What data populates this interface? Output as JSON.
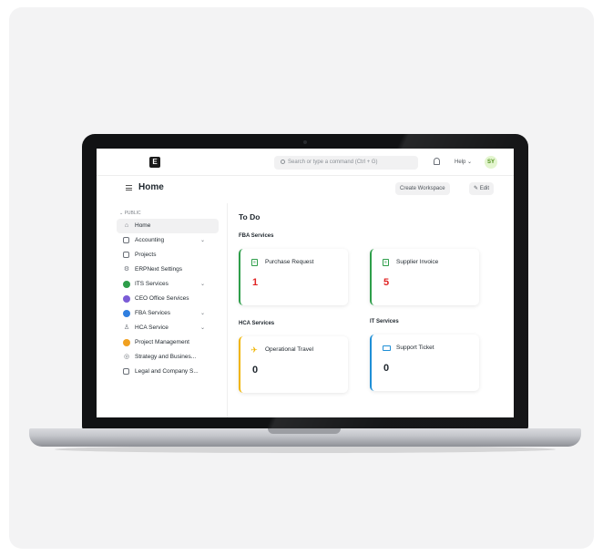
{
  "navbar": {
    "logo_letter": "E",
    "search_placeholder": "Search or type a command (Ctrl + G)",
    "help_label": "Help ⌄",
    "avatar_initials": "SY"
  },
  "page": {
    "title": "Home",
    "create_workspace_label": "Create Workspace",
    "edit_label": "Edit"
  },
  "sidebar": {
    "section_label": "⌄ PUBLIC",
    "items": [
      {
        "label": "Home",
        "icon": "home-icon",
        "chevron": false
      },
      {
        "label": "Accounting",
        "icon": "accounting-icon",
        "chevron": true
      },
      {
        "label": "Projects",
        "icon": "folder-icon",
        "chevron": false
      },
      {
        "label": "ERPNext Settings",
        "icon": "settings-icon",
        "chevron": false
      },
      {
        "label": "ITS Services",
        "icon": "its-services-icon",
        "chevron": true,
        "color": "#2e9e4a"
      },
      {
        "label": "CEO Office Services",
        "icon": "ceo-office-icon",
        "chevron": false,
        "color": "#7b5cd6"
      },
      {
        "label": "FBA Services",
        "icon": "fba-services-icon",
        "chevron": true,
        "color": "#2f7fe0"
      },
      {
        "label": "HCA Service",
        "icon": "hca-service-icon",
        "chevron": true
      },
      {
        "label": "Project Management",
        "icon": "project-management-icon",
        "chevron": false,
        "color": "#f0a020"
      },
      {
        "label": "Strategy and Busines...",
        "icon": "strategy-icon",
        "chevron": false
      },
      {
        "label": "Legal and Company S...",
        "icon": "legal-icon",
        "chevron": false
      }
    ]
  },
  "main": {
    "heading": "To Do",
    "groups": {
      "fba": "FBA Services",
      "hca": "HCA Services",
      "it": "IT Services"
    },
    "cards": {
      "purchase_request": {
        "label": "Purchase Request",
        "count": "1",
        "accent": "#2e9e4a",
        "count_color": "#e02424"
      },
      "supplier_invoice": {
        "label": "Supplier Invoice",
        "count": "5",
        "accent": "#2e9e4a",
        "count_color": "#e02424"
      },
      "operational_travel": {
        "label": "Operational Travel",
        "count": "0",
        "accent": "#f0b400",
        "count_color": "#1f272e"
      },
      "support_ticket": {
        "label": "Support Ticket",
        "count": "0",
        "accent": "#1f8fd6",
        "count_color": "#1f272e"
      }
    }
  }
}
